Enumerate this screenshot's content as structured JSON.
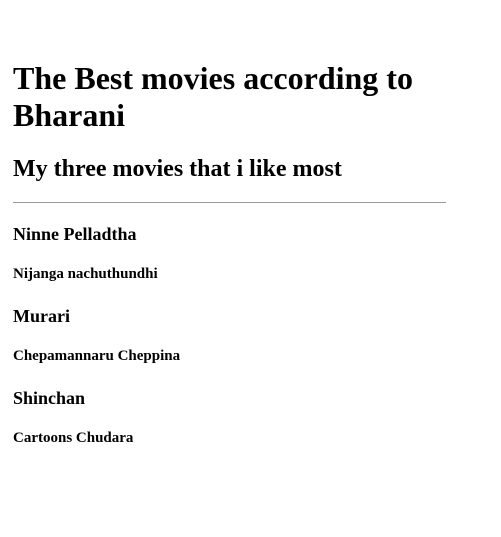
{
  "page": {
    "title": "The Best movies according to Bharani",
    "subtitle": "My three movies that i like most"
  },
  "movies": [
    {
      "name": "Ninne Pelladtha",
      "note": "Nijanga nachuthundhi"
    },
    {
      "name": "Murari",
      "note": "Chepamannaru Cheppina"
    },
    {
      "name": "Shinchan",
      "note": "Cartoons Chudara"
    }
  ]
}
